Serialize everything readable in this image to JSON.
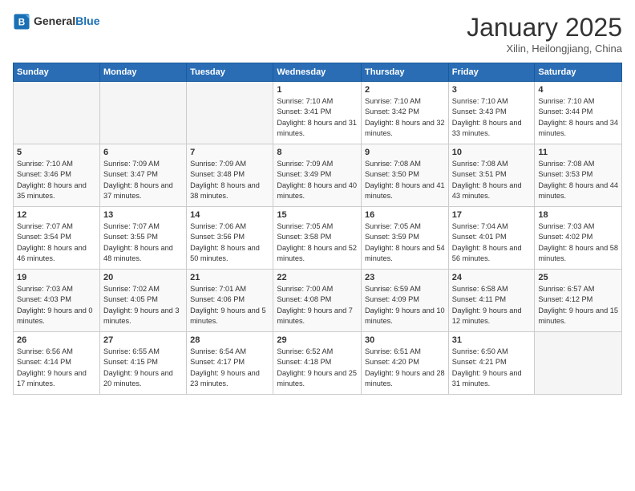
{
  "header": {
    "logo_general": "General",
    "logo_blue": "Blue",
    "title": "January 2025",
    "location": "Xilin, Heilongjiang, China"
  },
  "weekdays": [
    "Sunday",
    "Monday",
    "Tuesday",
    "Wednesday",
    "Thursday",
    "Friday",
    "Saturday"
  ],
  "weeks": [
    [
      {
        "day": "",
        "sunrise": "",
        "sunset": "",
        "daylight": ""
      },
      {
        "day": "",
        "sunrise": "",
        "sunset": "",
        "daylight": ""
      },
      {
        "day": "",
        "sunrise": "",
        "sunset": "",
        "daylight": ""
      },
      {
        "day": "1",
        "sunrise": "Sunrise: 7:10 AM",
        "sunset": "Sunset: 3:41 PM",
        "daylight": "Daylight: 8 hours and 31 minutes."
      },
      {
        "day": "2",
        "sunrise": "Sunrise: 7:10 AM",
        "sunset": "Sunset: 3:42 PM",
        "daylight": "Daylight: 8 hours and 32 minutes."
      },
      {
        "day": "3",
        "sunrise": "Sunrise: 7:10 AM",
        "sunset": "Sunset: 3:43 PM",
        "daylight": "Daylight: 8 hours and 33 minutes."
      },
      {
        "day": "4",
        "sunrise": "Sunrise: 7:10 AM",
        "sunset": "Sunset: 3:44 PM",
        "daylight": "Daylight: 8 hours and 34 minutes."
      }
    ],
    [
      {
        "day": "5",
        "sunrise": "Sunrise: 7:10 AM",
        "sunset": "Sunset: 3:46 PM",
        "daylight": "Daylight: 8 hours and 35 minutes."
      },
      {
        "day": "6",
        "sunrise": "Sunrise: 7:09 AM",
        "sunset": "Sunset: 3:47 PM",
        "daylight": "Daylight: 8 hours and 37 minutes."
      },
      {
        "day": "7",
        "sunrise": "Sunrise: 7:09 AM",
        "sunset": "Sunset: 3:48 PM",
        "daylight": "Daylight: 8 hours and 38 minutes."
      },
      {
        "day": "8",
        "sunrise": "Sunrise: 7:09 AM",
        "sunset": "Sunset: 3:49 PM",
        "daylight": "Daylight: 8 hours and 40 minutes."
      },
      {
        "day": "9",
        "sunrise": "Sunrise: 7:08 AM",
        "sunset": "Sunset: 3:50 PM",
        "daylight": "Daylight: 8 hours and 41 minutes."
      },
      {
        "day": "10",
        "sunrise": "Sunrise: 7:08 AM",
        "sunset": "Sunset: 3:51 PM",
        "daylight": "Daylight: 8 hours and 43 minutes."
      },
      {
        "day": "11",
        "sunrise": "Sunrise: 7:08 AM",
        "sunset": "Sunset: 3:53 PM",
        "daylight": "Daylight: 8 hours and 44 minutes."
      }
    ],
    [
      {
        "day": "12",
        "sunrise": "Sunrise: 7:07 AM",
        "sunset": "Sunset: 3:54 PM",
        "daylight": "Daylight: 8 hours and 46 minutes."
      },
      {
        "day": "13",
        "sunrise": "Sunrise: 7:07 AM",
        "sunset": "Sunset: 3:55 PM",
        "daylight": "Daylight: 8 hours and 48 minutes."
      },
      {
        "day": "14",
        "sunrise": "Sunrise: 7:06 AM",
        "sunset": "Sunset: 3:56 PM",
        "daylight": "Daylight: 8 hours and 50 minutes."
      },
      {
        "day": "15",
        "sunrise": "Sunrise: 7:05 AM",
        "sunset": "Sunset: 3:58 PM",
        "daylight": "Daylight: 8 hours and 52 minutes."
      },
      {
        "day": "16",
        "sunrise": "Sunrise: 7:05 AM",
        "sunset": "Sunset: 3:59 PM",
        "daylight": "Daylight: 8 hours and 54 minutes."
      },
      {
        "day": "17",
        "sunrise": "Sunrise: 7:04 AM",
        "sunset": "Sunset: 4:01 PM",
        "daylight": "Daylight: 8 hours and 56 minutes."
      },
      {
        "day": "18",
        "sunrise": "Sunrise: 7:03 AM",
        "sunset": "Sunset: 4:02 PM",
        "daylight": "Daylight: 8 hours and 58 minutes."
      }
    ],
    [
      {
        "day": "19",
        "sunrise": "Sunrise: 7:03 AM",
        "sunset": "Sunset: 4:03 PM",
        "daylight": "Daylight: 9 hours and 0 minutes."
      },
      {
        "day": "20",
        "sunrise": "Sunrise: 7:02 AM",
        "sunset": "Sunset: 4:05 PM",
        "daylight": "Daylight: 9 hours and 3 minutes."
      },
      {
        "day": "21",
        "sunrise": "Sunrise: 7:01 AM",
        "sunset": "Sunset: 4:06 PM",
        "daylight": "Daylight: 9 hours and 5 minutes."
      },
      {
        "day": "22",
        "sunrise": "Sunrise: 7:00 AM",
        "sunset": "Sunset: 4:08 PM",
        "daylight": "Daylight: 9 hours and 7 minutes."
      },
      {
        "day": "23",
        "sunrise": "Sunrise: 6:59 AM",
        "sunset": "Sunset: 4:09 PM",
        "daylight": "Daylight: 9 hours and 10 minutes."
      },
      {
        "day": "24",
        "sunrise": "Sunrise: 6:58 AM",
        "sunset": "Sunset: 4:11 PM",
        "daylight": "Daylight: 9 hours and 12 minutes."
      },
      {
        "day": "25",
        "sunrise": "Sunrise: 6:57 AM",
        "sunset": "Sunset: 4:12 PM",
        "daylight": "Daylight: 9 hours and 15 minutes."
      }
    ],
    [
      {
        "day": "26",
        "sunrise": "Sunrise: 6:56 AM",
        "sunset": "Sunset: 4:14 PM",
        "daylight": "Daylight: 9 hours and 17 minutes."
      },
      {
        "day": "27",
        "sunrise": "Sunrise: 6:55 AM",
        "sunset": "Sunset: 4:15 PM",
        "daylight": "Daylight: 9 hours and 20 minutes."
      },
      {
        "day": "28",
        "sunrise": "Sunrise: 6:54 AM",
        "sunset": "Sunset: 4:17 PM",
        "daylight": "Daylight: 9 hours and 23 minutes."
      },
      {
        "day": "29",
        "sunrise": "Sunrise: 6:52 AM",
        "sunset": "Sunset: 4:18 PM",
        "daylight": "Daylight: 9 hours and 25 minutes."
      },
      {
        "day": "30",
        "sunrise": "Sunrise: 6:51 AM",
        "sunset": "Sunset: 4:20 PM",
        "daylight": "Daylight: 9 hours and 28 minutes."
      },
      {
        "day": "31",
        "sunrise": "Sunrise: 6:50 AM",
        "sunset": "Sunset: 4:21 PM",
        "daylight": "Daylight: 9 hours and 31 minutes."
      },
      {
        "day": "",
        "sunrise": "",
        "sunset": "",
        "daylight": ""
      }
    ]
  ]
}
